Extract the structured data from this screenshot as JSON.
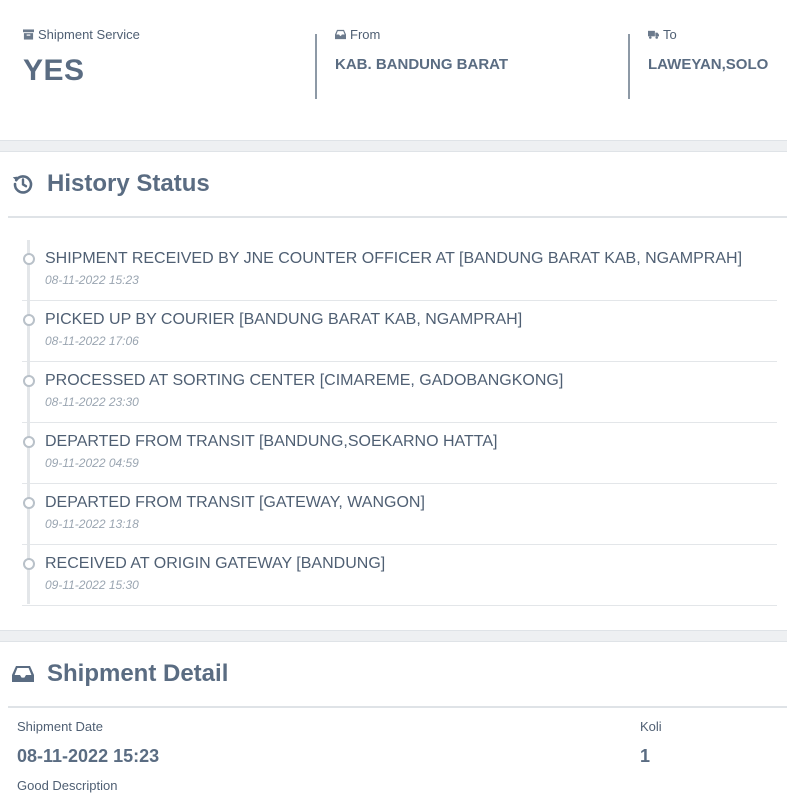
{
  "summary": {
    "service_label": "Shipment Service",
    "service_value": "YES",
    "from_label": "From",
    "from_value": "KAB. BANDUNG BARAT",
    "to_label": "To",
    "to_value": "LAWEYAN,SOLO"
  },
  "history": {
    "title": "History Status",
    "items": [
      {
        "status": "SHIPMENT RECEIVED BY JNE COUNTER OFFICER AT [BANDUNG BARAT KAB, NGAMPRAH]",
        "date": "08-11-2022 15:23"
      },
      {
        "status": "PICKED UP BY COURIER [BANDUNG BARAT KAB, NGAMPRAH]",
        "date": "08-11-2022 17:06"
      },
      {
        "status": "PROCESSED AT SORTING CENTER [CIMAREME, GADOBANGKONG]",
        "date": "08-11-2022 23:30"
      },
      {
        "status": "DEPARTED FROM TRANSIT [BANDUNG,SOEKARNO HATTA]",
        "date": "09-11-2022 04:59"
      },
      {
        "status": "DEPARTED FROM TRANSIT [GATEWAY, WANGON]",
        "date": "09-11-2022 13:18"
      },
      {
        "status": "RECEIVED AT ORIGIN GATEWAY [BANDUNG]",
        "date": "09-11-2022 15:30"
      }
    ]
  },
  "detail": {
    "title": "Shipment Detail",
    "date_label": "Shipment Date",
    "date_value": "08-11-2022 15:23",
    "koli_label": "Koli",
    "koli_value": "1",
    "good_desc_label": "Good Description"
  }
}
